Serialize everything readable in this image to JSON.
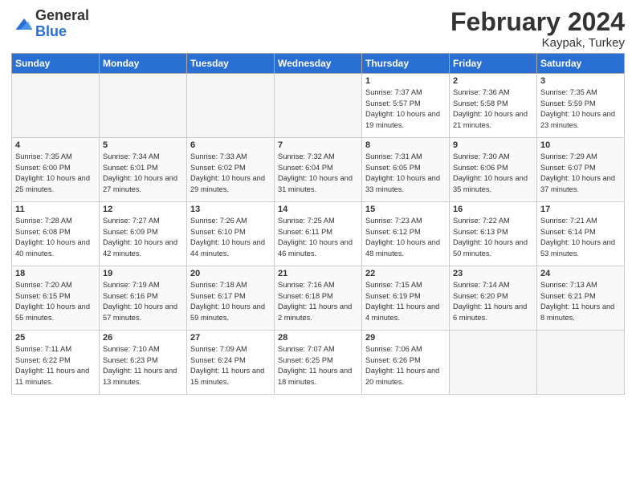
{
  "logo": {
    "general": "General",
    "blue": "Blue"
  },
  "title": "February 2024",
  "location": "Kaypak, Turkey",
  "days_of_week": [
    "Sunday",
    "Monday",
    "Tuesday",
    "Wednesday",
    "Thursday",
    "Friday",
    "Saturday"
  ],
  "weeks": [
    [
      {
        "day": "",
        "empty": true
      },
      {
        "day": "",
        "empty": true
      },
      {
        "day": "",
        "empty": true
      },
      {
        "day": "",
        "empty": true
      },
      {
        "day": "1",
        "sunrise": "7:37 AM",
        "sunset": "5:57 PM",
        "daylight": "10 hours and 19 minutes."
      },
      {
        "day": "2",
        "sunrise": "7:36 AM",
        "sunset": "5:58 PM",
        "daylight": "10 hours and 21 minutes."
      },
      {
        "day": "3",
        "sunrise": "7:35 AM",
        "sunset": "5:59 PM",
        "daylight": "10 hours and 23 minutes."
      }
    ],
    [
      {
        "day": "4",
        "sunrise": "7:35 AM",
        "sunset": "6:00 PM",
        "daylight": "10 hours and 25 minutes."
      },
      {
        "day": "5",
        "sunrise": "7:34 AM",
        "sunset": "6:01 PM",
        "daylight": "10 hours and 27 minutes."
      },
      {
        "day": "6",
        "sunrise": "7:33 AM",
        "sunset": "6:02 PM",
        "daylight": "10 hours and 29 minutes."
      },
      {
        "day": "7",
        "sunrise": "7:32 AM",
        "sunset": "6:04 PM",
        "daylight": "10 hours and 31 minutes."
      },
      {
        "day": "8",
        "sunrise": "7:31 AM",
        "sunset": "6:05 PM",
        "daylight": "10 hours and 33 minutes."
      },
      {
        "day": "9",
        "sunrise": "7:30 AM",
        "sunset": "6:06 PM",
        "daylight": "10 hours and 35 minutes."
      },
      {
        "day": "10",
        "sunrise": "7:29 AM",
        "sunset": "6:07 PM",
        "daylight": "10 hours and 37 minutes."
      }
    ],
    [
      {
        "day": "11",
        "sunrise": "7:28 AM",
        "sunset": "6:08 PM",
        "daylight": "10 hours and 40 minutes."
      },
      {
        "day": "12",
        "sunrise": "7:27 AM",
        "sunset": "6:09 PM",
        "daylight": "10 hours and 42 minutes."
      },
      {
        "day": "13",
        "sunrise": "7:26 AM",
        "sunset": "6:10 PM",
        "daylight": "10 hours and 44 minutes."
      },
      {
        "day": "14",
        "sunrise": "7:25 AM",
        "sunset": "6:11 PM",
        "daylight": "10 hours and 46 minutes."
      },
      {
        "day": "15",
        "sunrise": "7:23 AM",
        "sunset": "6:12 PM",
        "daylight": "10 hours and 48 minutes."
      },
      {
        "day": "16",
        "sunrise": "7:22 AM",
        "sunset": "6:13 PM",
        "daylight": "10 hours and 50 minutes."
      },
      {
        "day": "17",
        "sunrise": "7:21 AM",
        "sunset": "6:14 PM",
        "daylight": "10 hours and 53 minutes."
      }
    ],
    [
      {
        "day": "18",
        "sunrise": "7:20 AM",
        "sunset": "6:15 PM",
        "daylight": "10 hours and 55 minutes."
      },
      {
        "day": "19",
        "sunrise": "7:19 AM",
        "sunset": "6:16 PM",
        "daylight": "10 hours and 57 minutes."
      },
      {
        "day": "20",
        "sunrise": "7:18 AM",
        "sunset": "6:17 PM",
        "daylight": "10 hours and 59 minutes."
      },
      {
        "day": "21",
        "sunrise": "7:16 AM",
        "sunset": "6:18 PM",
        "daylight": "11 hours and 2 minutes."
      },
      {
        "day": "22",
        "sunrise": "7:15 AM",
        "sunset": "6:19 PM",
        "daylight": "11 hours and 4 minutes."
      },
      {
        "day": "23",
        "sunrise": "7:14 AM",
        "sunset": "6:20 PM",
        "daylight": "11 hours and 6 minutes."
      },
      {
        "day": "24",
        "sunrise": "7:13 AM",
        "sunset": "6:21 PM",
        "daylight": "11 hours and 8 minutes."
      }
    ],
    [
      {
        "day": "25",
        "sunrise": "7:11 AM",
        "sunset": "6:22 PM",
        "daylight": "11 hours and 11 minutes."
      },
      {
        "day": "26",
        "sunrise": "7:10 AM",
        "sunset": "6:23 PM",
        "daylight": "11 hours and 13 minutes."
      },
      {
        "day": "27",
        "sunrise": "7:09 AM",
        "sunset": "6:24 PM",
        "daylight": "11 hours and 15 minutes."
      },
      {
        "day": "28",
        "sunrise": "7:07 AM",
        "sunset": "6:25 PM",
        "daylight": "11 hours and 18 minutes."
      },
      {
        "day": "29",
        "sunrise": "7:06 AM",
        "sunset": "6:26 PM",
        "daylight": "11 hours and 20 minutes."
      },
      {
        "day": "",
        "empty": true
      },
      {
        "day": "",
        "empty": true
      }
    ]
  ]
}
